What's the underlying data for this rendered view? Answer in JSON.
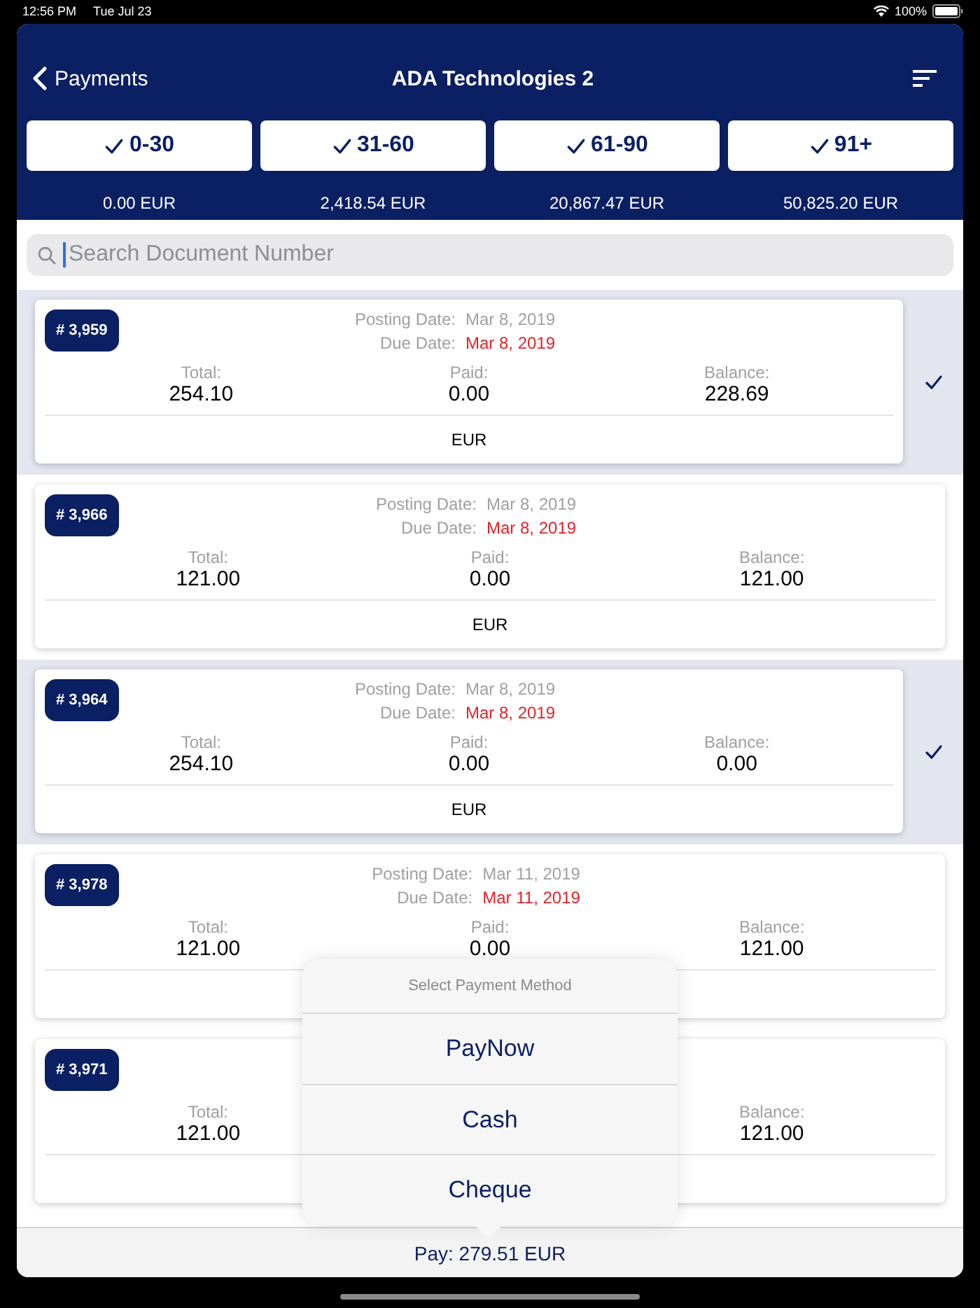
{
  "status_bar": {
    "time": "12:56 PM",
    "date": "Tue Jul 23",
    "battery": "100%"
  },
  "nav": {
    "back": "Payments",
    "title": "ADA Technologies 2"
  },
  "age_filters": [
    {
      "label": "0-30",
      "checked": true,
      "amount": "0.00 EUR"
    },
    {
      "label": "31-60",
      "checked": true,
      "amount": "2,418.54 EUR"
    },
    {
      "label": "61-90",
      "checked": true,
      "amount": "20,867.47 EUR"
    },
    {
      "label": "91+",
      "checked": true,
      "amount": "50,825.20 EUR"
    }
  ],
  "search": {
    "placeholder": "Search Document Number"
  },
  "documents": [
    {
      "number": "# 3,959",
      "selected": true,
      "posting_label": "Posting Date:",
      "posting_date": "Mar 8, 2019",
      "due_label": "Due Date:",
      "due_date": "Mar 8, 2019",
      "total_label": "Total:",
      "total": "254.10",
      "paid_label": "Paid:",
      "paid": "0.00",
      "balance_label": "Balance:",
      "balance": "228.69",
      "currency": "EUR"
    },
    {
      "number": "# 3,966",
      "selected": false,
      "posting_label": "Posting Date:",
      "posting_date": "Mar 8, 2019",
      "due_label": "Due Date:",
      "due_date": "Mar 8, 2019",
      "total_label": "Total:",
      "total": "121.00",
      "paid_label": "Paid:",
      "paid": "0.00",
      "balance_label": "Balance:",
      "balance": "121.00",
      "currency": "EUR"
    },
    {
      "number": "# 3,964",
      "selected": true,
      "posting_label": "Posting Date:",
      "posting_date": "Mar 8, 2019",
      "due_label": "Due Date:",
      "due_date": "Mar 8, 2019",
      "total_label": "Total:",
      "total": "254.10",
      "paid_label": "Paid:",
      "paid": "0.00",
      "balance_label": "Balance:",
      "balance": "0.00",
      "currency": "EUR"
    },
    {
      "number": "# 3,978",
      "selected": false,
      "posting_label": "Posting Date:",
      "posting_date": "Mar 11, 2019",
      "due_label": "Due Date:",
      "due_date": "Mar 11, 2019",
      "total_label": "Total:",
      "total": "121.00",
      "paid_label": "Paid:",
      "paid": "0.00",
      "balance_label": "Balance:",
      "balance": "121.00"
    },
    {
      "number": "# 3,971",
      "selected": false,
      "total_label": "Total:",
      "total": "121.00",
      "balance_label": "Balance:",
      "balance": "121.00"
    }
  ],
  "payment_menu": {
    "title": "Select Payment Method",
    "options": [
      "PayNow",
      "Cash",
      "Cheque"
    ]
  },
  "pay_button": "Pay: 279.51 EUR"
}
